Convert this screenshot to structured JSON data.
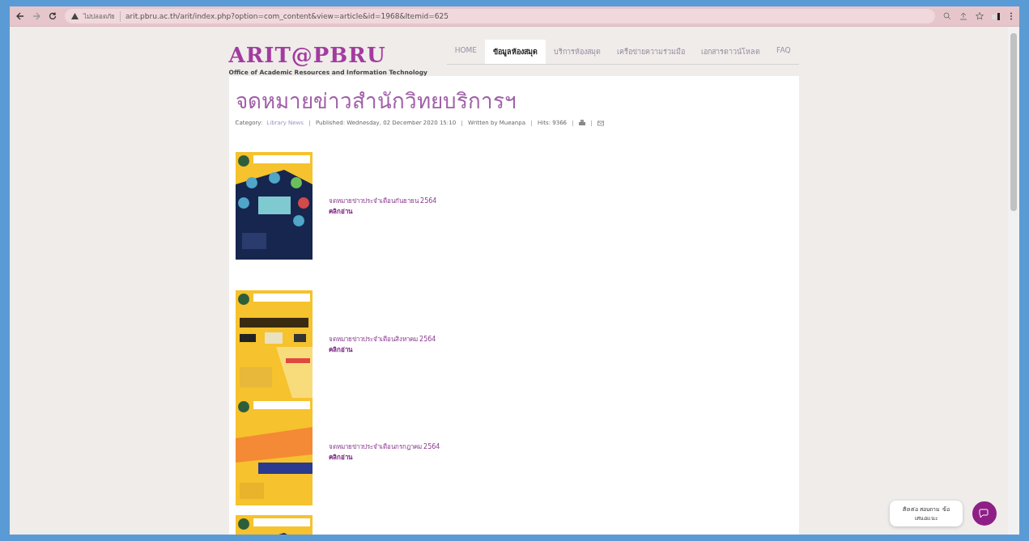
{
  "browser": {
    "security": "ไม่ปลอดภัย",
    "url": "arit.pbru.ac.th/arit/index.php?option=com_content&view=article&id=1968&Itemid=625"
  },
  "site": {
    "logo": "ARIT@PBRU",
    "tagline": "Office of Academic Resources and Information Technology"
  },
  "nav": [
    {
      "label": "HOME",
      "selected": false
    },
    {
      "label": "ข้อมูลห้องสมุด",
      "selected": true
    },
    {
      "label": "บริการห้องสมุด",
      "selected": false
    },
    {
      "label": "เครือข่ายความร่วมมือ",
      "selected": false
    },
    {
      "label": "เอกสารดาวน์โหลด",
      "selected": false
    },
    {
      "label": "FAQ",
      "selected": false
    }
  ],
  "article": {
    "title": "จดหมายข่าวสำนักวิทยบริการฯ",
    "meta": {
      "category_label": "Category:",
      "category": "Library News",
      "published": "Published: Wednesday, 02 December 2020 15:10",
      "author": "Written by Mueanpa",
      "hits": "Hits: 9366"
    },
    "items": [
      {
        "kind": "picture",
        "title": "จดหมายข่าวประจำเดือนกันยายน 2564",
        "link": "คลิกอ่าน"
      },
      {
        "kind": "picture",
        "title": "จดหมายข่าวประจำเดือนสิงหาคม 2564",
        "link": "คลิกอ่าน"
      },
      {
        "kind": "picture",
        "title": "จดหมายข่าวประจำเดือนกรกฎาคม 2564",
        "link": "คลิกอ่าน"
      },
      {
        "kind": "picture"
      }
    ]
  },
  "chat": {
    "label": "ติดต่อ สอบถาม ข้อเสนอแนะ"
  }
}
